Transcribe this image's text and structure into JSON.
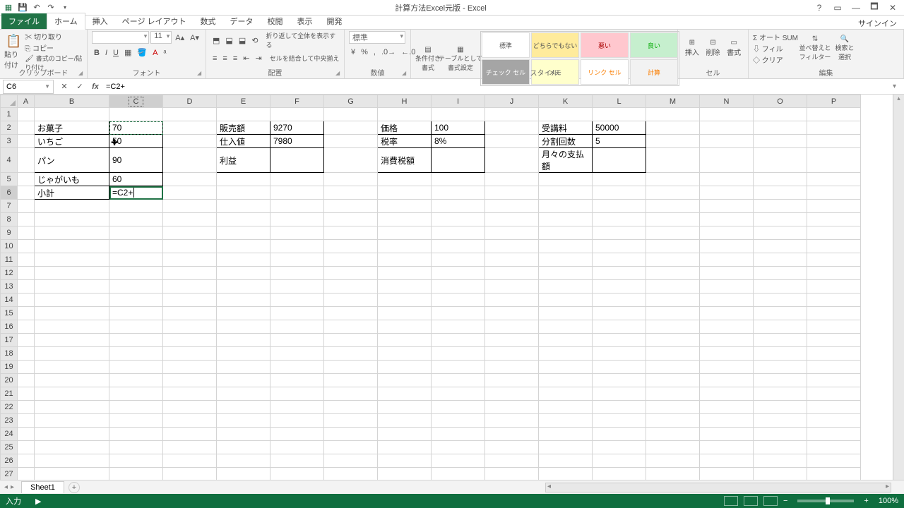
{
  "titlebar": {
    "doc": "計算方法Excel元版 - Excel",
    "qat": [
      "excel-icon",
      "save-icon",
      "undo-icon",
      "redo-icon"
    ]
  },
  "tabs": {
    "file": "ファイル",
    "items": [
      "ホーム",
      "挿入",
      "ページ レイアウト",
      "数式",
      "データ",
      "校閲",
      "表示",
      "開発"
    ],
    "active": "ホーム",
    "signin": "サインイン"
  },
  "ribbon": {
    "clipboard": {
      "label": "クリップボード",
      "paste": "貼り付け",
      "cut": "切り取り",
      "copy": "コピー",
      "painter": "書式のコピー/貼り付け"
    },
    "font": {
      "label": "フォント",
      "size": "11"
    },
    "alignment": {
      "label": "配置",
      "wrap": "折り返して全体を表示する",
      "merge": "セルを結合して中央揃え"
    },
    "number": {
      "label": "数値",
      "format": "標準"
    },
    "styles": {
      "label": "スタイル",
      "cond": "条件付き\n書式",
      "table": "テーブルとして\n書式設定",
      "gallery": [
        "標準",
        "どちらでもない",
        "悪い",
        "良い",
        "チェック セル",
        "メモ",
        "リンク セル",
        "計算"
      ]
    },
    "cells": {
      "label": "セル",
      "insert": "挿入",
      "delete": "削除",
      "format": "書式"
    },
    "editing": {
      "label": "編集",
      "autosum": "オート SUM",
      "fill": "フィル",
      "clear": "クリア",
      "sort": "並べ替えと\nフィルター",
      "find": "検索と\n選択"
    }
  },
  "nameBox": "C6",
  "formula": "=C2+",
  "columns": [
    "A",
    "B",
    "C",
    "D",
    "E",
    "F",
    "G",
    "H",
    "I",
    "J",
    "K",
    "L",
    "M",
    "N",
    "O",
    "P"
  ],
  "rows": 27,
  "activeCol": "C",
  "activeRow": 6,
  "marchingCell": "C2",
  "cursorCell": "C3",
  "cells": {
    "B2": "お菓子",
    "C2": "70",
    "B3": "いちご",
    "C3": "50",
    "B4": "パン",
    "C4": "90",
    "B5": "じゃがいも",
    "C5": "60",
    "B6": "小計",
    "C6": "=C2+",
    "E2": "販売額",
    "F2": "9270",
    "E3": "仕入値",
    "F3": "7980",
    "E4": "利益",
    "H2": "価格",
    "I2": "100",
    "H3": "税率",
    "I3": "8%",
    "H4": "消費税額",
    "K2": "受講料",
    "L2": "50000",
    "K3": "分割回数",
    "L3": "5",
    "K4": "月々の支払額"
  },
  "borderRanges": [
    {
      "r1": 2,
      "c1": "B",
      "r2": 6,
      "c2": "C"
    },
    {
      "r1": 2,
      "c1": "E",
      "r2": 4,
      "c2": "F"
    },
    {
      "r1": 2,
      "c1": "H",
      "r2": 4,
      "c2": "I"
    },
    {
      "r1": 2,
      "c1": "K",
      "r2": 4,
      "c2": "L"
    }
  ],
  "numericCols": [
    "C",
    "F",
    "I",
    "L"
  ],
  "sheet": {
    "name": "Sheet1"
  },
  "status": {
    "mode": "入力",
    "zoom": "100%"
  }
}
